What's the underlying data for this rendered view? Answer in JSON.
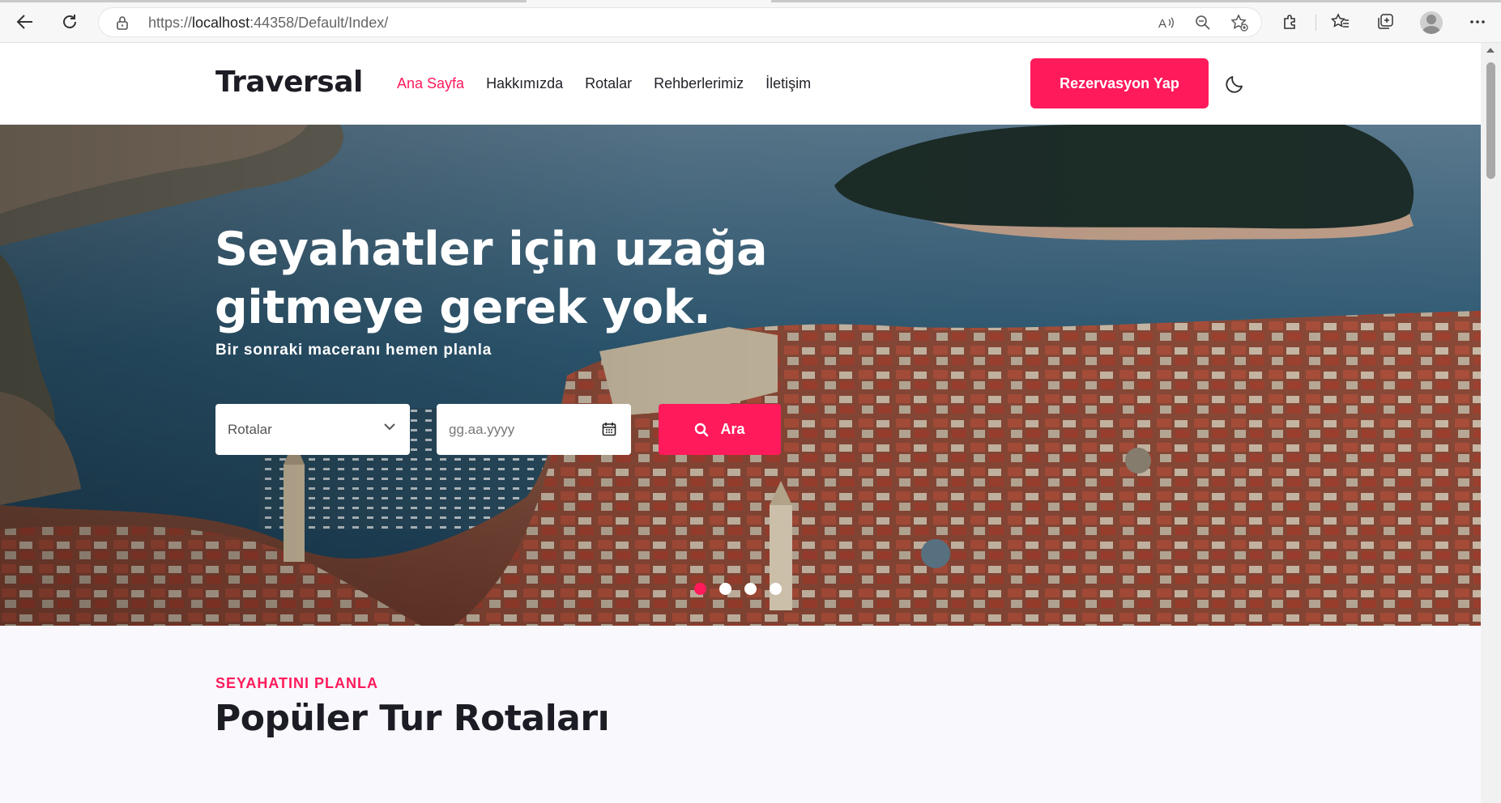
{
  "browser": {
    "url_prefix": "https://",
    "url_host": "localhost",
    "url_rest": ":44358/Default/Index/"
  },
  "site": {
    "brand": "Traversal",
    "menu": [
      {
        "label": "Ana Sayfa",
        "active": true
      },
      {
        "label": "Hakkımızda",
        "active": false
      },
      {
        "label": "Rotalar",
        "active": false
      },
      {
        "label": "Rehberlerimiz",
        "active": false
      },
      {
        "label": "İletişim",
        "active": false
      }
    ],
    "cta_label": "Rezervasyon Yap",
    "accent_color": "#ff1a5b"
  },
  "hero": {
    "title_line1": "Seyahatler için uzağa",
    "title_line2": "gitmeye gerek yok.",
    "subtitle": "Bir sonraki maceranı hemen planla",
    "route_select_value": "Rotalar",
    "date_placeholder": "gg.aa.yyyy",
    "search_button": "Ara",
    "slides_total": 4,
    "active_slide": 1
  },
  "section": {
    "kicker": "SEYAHATINI PLANLA",
    "title": "Popüler Tur Rotaları"
  }
}
